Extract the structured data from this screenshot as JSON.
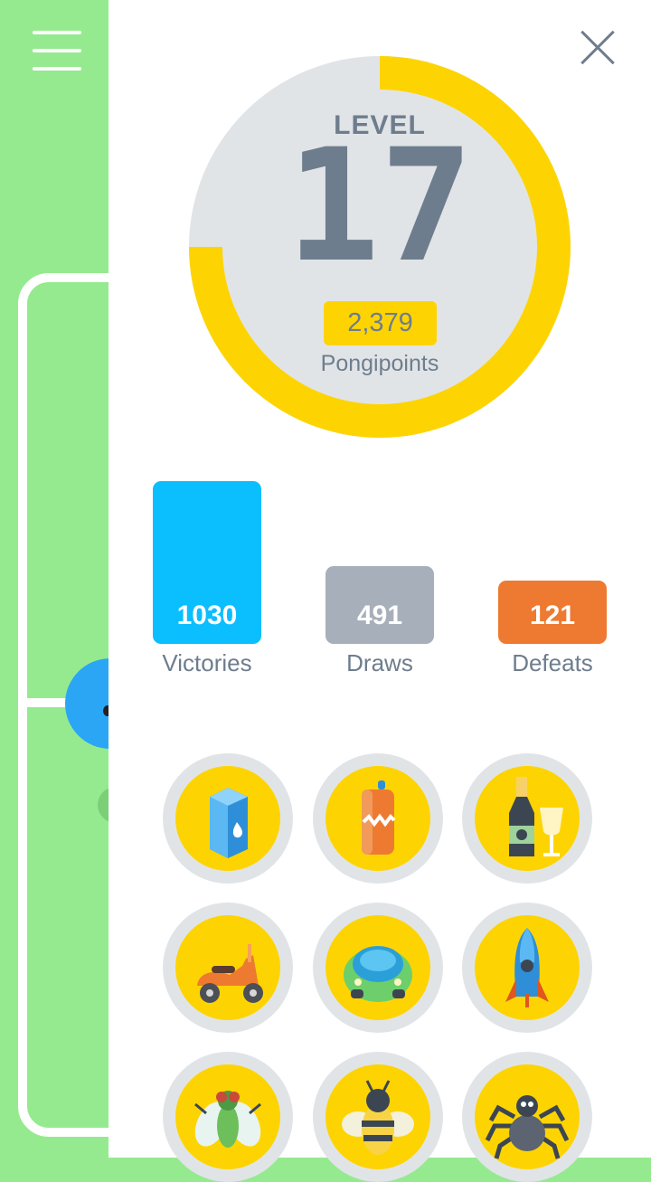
{
  "background": {
    "field_color": "#95ea8f",
    "menu_icon": "hamburger-menu-icon",
    "mascot": "blue-ball-mascot"
  },
  "panel": {
    "close_icon": "close-icon",
    "level": {
      "label": "LEVEL",
      "value": "17",
      "progress_fraction": 0.75,
      "points_value": "2,379",
      "points_label": "Pongipoints",
      "ring_color": "#fdd402",
      "track_color": "#e1e4e7"
    },
    "stats": [
      {
        "value": "1030",
        "label": "Victories",
        "color": "#0bbfff",
        "count": 1030
      },
      {
        "value": "491",
        "label": "Draws",
        "color": "#a7b0ba",
        "count": 491
      },
      {
        "value": "121",
        "label": "Defeats",
        "color": "#ee7a31",
        "count": 121
      }
    ],
    "badges": [
      {
        "icon": "milk-carton-icon"
      },
      {
        "icon": "soda-can-icon"
      },
      {
        "icon": "champagne-icon"
      },
      {
        "icon": "scooter-icon"
      },
      {
        "icon": "car-icon"
      },
      {
        "icon": "rocket-icon"
      },
      {
        "icon": "fly-icon"
      },
      {
        "icon": "bee-icon"
      },
      {
        "icon": "spider-icon"
      }
    ]
  }
}
